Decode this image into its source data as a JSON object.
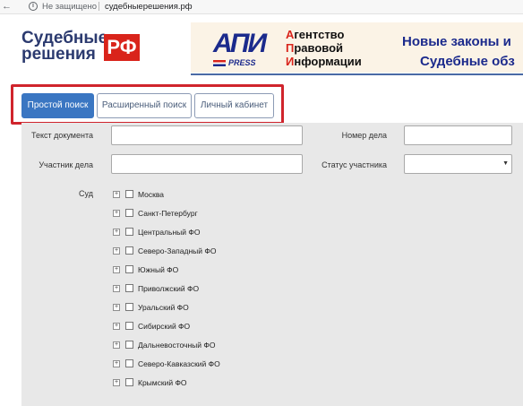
{
  "browser": {
    "security_text": "Не защищено",
    "url": "судебныерешения.рф",
    "back_glyph": "←",
    "info_glyph": "i"
  },
  "logo": {
    "line1": "Судебные",
    "line2": "решения",
    "badge": "РФ"
  },
  "banner": {
    "api_logo": "АПИ",
    "api_press": "PRESS",
    "agency_initials": [
      "А",
      "П",
      "И"
    ],
    "agency_rest": [
      "гентство",
      "равовой",
      "нформации"
    ],
    "headline1": "Новые законы и",
    "headline2": "Судебные обз"
  },
  "tabs": [
    {
      "label": "Простой поиск",
      "active": true
    },
    {
      "label": "Расширенный поиск",
      "active": false
    },
    {
      "label": "Личный кабинет",
      "active": false
    }
  ],
  "form": {
    "text_label": "Текст документа",
    "text_value": "",
    "case_number_label": "Номер дела",
    "case_number_value": "",
    "participant_label": "Участник дела",
    "participant_value": "",
    "status_label": "Статус участника",
    "status_value": "",
    "court_label": "Суд"
  },
  "courts": [
    "Москва",
    "Санкт-Петербург",
    "Центральный ФО",
    "Северо-Западный ФО",
    "Южный ФО",
    "Приволжский ФО",
    "Уральский ФО",
    "Сибирский ФО",
    "Дальневосточный ФО",
    "Северо-Кавказский ФО",
    "Крымский ФО"
  ],
  "colors": {
    "accent": "#3a76c2",
    "highlight": "#d0242c",
    "brand_red": "#d9241b",
    "brand_blue": "#1b2a8c"
  }
}
